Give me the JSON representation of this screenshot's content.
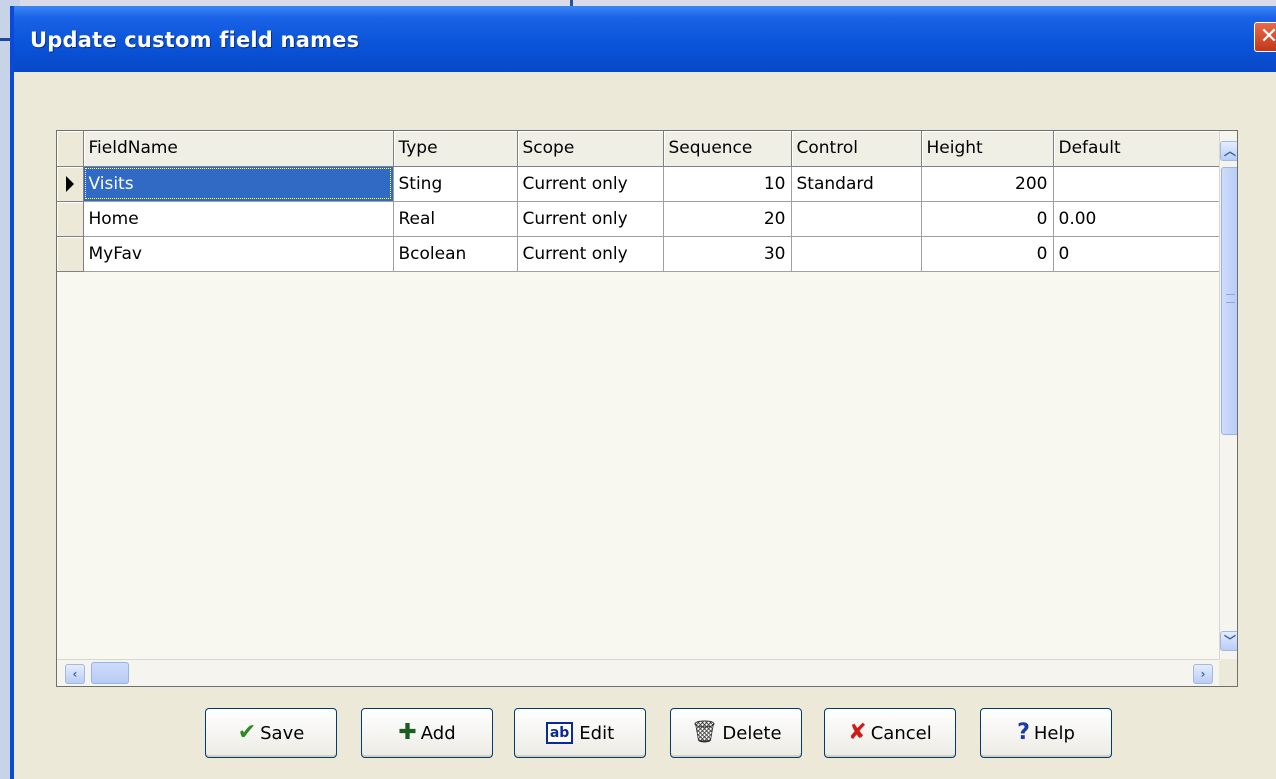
{
  "window": {
    "title": "Update custom field names",
    "close_glyph": "✕"
  },
  "grid": {
    "columns": [
      "FieldName",
      "Type",
      "Scope",
      "Sequence",
      "Control",
      "Height",
      "Default"
    ],
    "rows": [
      {
        "FieldName": "Visits",
        "Type": "Sting",
        "Scope": "Current only",
        "Sequence": "10",
        "Control": "Standard",
        "Height": "200",
        "Default": ""
      },
      {
        "FieldName": "Home",
        "Type": "Real",
        "Scope": "Current only",
        "Sequence": "20",
        "Control": "",
        "Height": "0",
        "Default": "0.00"
      },
      {
        "FieldName": "MyFav",
        "Type": "Bcolean",
        "Scope": "Current only",
        "Sequence": "30",
        "Control": "",
        "Height": "0",
        "Default": "0"
      }
    ],
    "selected_row": 0
  },
  "buttons": {
    "save": "Save",
    "add": "Add",
    "edit": "Edit",
    "edit_icon_text": "ab",
    "delete": "Delete",
    "cancel": "Cancel",
    "help": "Help"
  },
  "icons": {
    "save": "checkmark-icon",
    "add": "plus-icon",
    "edit": "edit-field-icon",
    "delete": "trash-icon",
    "cancel": "red-x-icon",
    "help": "question-mark-icon"
  },
  "colors": {
    "titlebar": "#0a55da",
    "selection": "#316ac5",
    "dialog_bg": "#ece9d8"
  }
}
